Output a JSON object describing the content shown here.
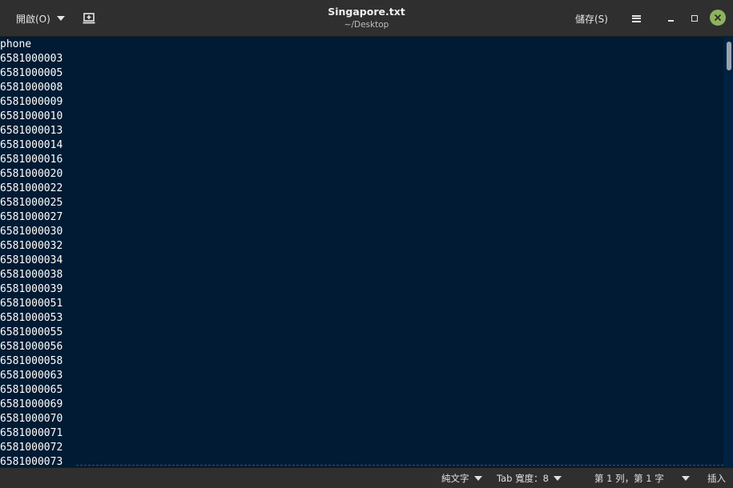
{
  "header": {
    "open_label": "開啟(O)",
    "title": "Singapore.txt",
    "subtitle": "~/Desktop",
    "save_label": "儲存(S)"
  },
  "icons": {
    "open_dropdown": "chevron-down-icon",
    "new_tab": "new-document-icon",
    "menu": "hamburger-menu-icon",
    "minimize": "minimize-icon",
    "maximize": "maximize-icon",
    "close": "close-icon"
  },
  "colors": {
    "editor_background": "#001b33",
    "editor_text": "#ffffff",
    "close_button": "#8fb25f",
    "chrome": "#2f2f2f"
  },
  "editor": {
    "lines": [
      "phone",
      "6581000003",
      "6581000005",
      "6581000008",
      "6581000009",
      "6581000010",
      "6581000013",
      "6581000014",
      "6581000016",
      "6581000020",
      "6581000022",
      "6581000025",
      "6581000027",
      "6581000030",
      "6581000032",
      "6581000034",
      "6581000038",
      "6581000039",
      "6581000051",
      "6581000053",
      "6581000055",
      "6581000056",
      "6581000058",
      "6581000063",
      "6581000065",
      "6581000069",
      "6581000070",
      "6581000071",
      "6581000072",
      "6581000073"
    ]
  },
  "statusbar": {
    "syntax": "純文字",
    "tab_width": "Tab 寬度：8",
    "cursor_position": "第 1 列，第 1 字",
    "insert_mode": "插入"
  }
}
